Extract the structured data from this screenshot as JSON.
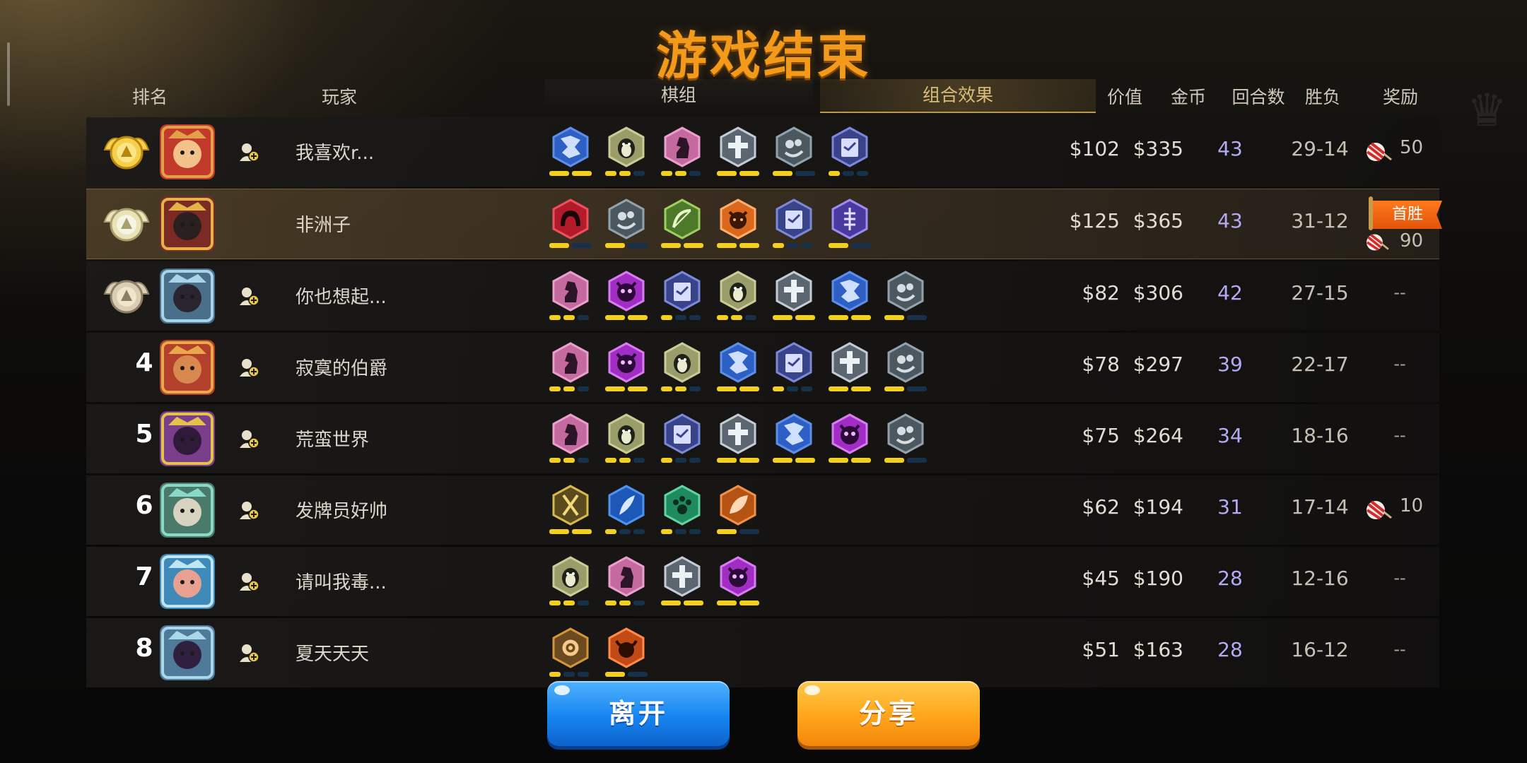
{
  "title": "游戏结束",
  "header": {
    "rank": "排名",
    "player": "玩家",
    "tab_pieces": "棋组",
    "tab_combos": "组合效果",
    "value": "价值",
    "gold": "金币",
    "rounds": "回合数",
    "winloss": "胜负",
    "reward": "奖励"
  },
  "colors": {
    "title": "#f39a1a",
    "rounds": "#b5a9f3",
    "bar_on": "#f3cf1e",
    "bar_off": "#163149"
  },
  "rows": [
    {
      "rank": "",
      "medal": "gold",
      "name": "我喜欢r...",
      "value": "$102",
      "gold": "$335",
      "rounds": "43",
      "wl": "29-14",
      "reward": "50",
      "first_win": "",
      "traits": [
        {
          "icon": "blue-rune-icon",
          "bars": [
            1,
            1
          ]
        },
        {
          "icon": "penguin-icon",
          "bars": [
            1,
            1,
            0
          ]
        },
        {
          "icon": "pink-knight-icon",
          "bars": [
            1,
            1,
            0
          ]
        },
        {
          "icon": "cross-icon",
          "bars": [
            1,
            1
          ]
        },
        {
          "icon": "grey-swirl-icon",
          "bars": [
            1,
            0
          ]
        },
        {
          "icon": "book-icon",
          "bars": [
            1,
            0,
            0
          ]
        }
      ]
    },
    {
      "rank": "",
      "medal": "silver",
      "name": "非洲子",
      "value": "$125",
      "gold": "$365",
      "rounds": "43",
      "wl": "31-12",
      "reward": "90",
      "first_win": "首胜",
      "traits": [
        {
          "icon": "red-arch-icon",
          "bars": [
            1,
            0
          ]
        },
        {
          "icon": "grey-swirl-icon",
          "bars": [
            1,
            0
          ]
        },
        {
          "icon": "bow-icon",
          "bars": [
            1,
            1
          ]
        },
        {
          "icon": "orange-demon-icon",
          "bars": [
            1,
            1
          ]
        },
        {
          "icon": "book-icon",
          "bars": [
            1,
            0,
            0
          ]
        },
        {
          "icon": "purple-fish-icon",
          "bars": [
            1,
            0
          ]
        }
      ]
    },
    {
      "rank": "",
      "medal": "bronze",
      "name": "你也想起...",
      "value": "$82",
      "gold": "$306",
      "rounds": "42",
      "wl": "27-15",
      "reward": "--",
      "first_win": "",
      "traits": [
        {
          "icon": "pink-knight-icon",
          "bars": [
            1,
            1,
            0
          ]
        },
        {
          "icon": "purple-demon-icon",
          "bars": [
            1,
            1
          ]
        },
        {
          "icon": "book-icon",
          "bars": [
            1,
            0,
            0
          ]
        },
        {
          "icon": "penguin-icon",
          "bars": [
            1,
            1,
            0
          ]
        },
        {
          "icon": "cross-icon",
          "bars": [
            1,
            1
          ]
        },
        {
          "icon": "blue-rune-icon",
          "bars": [
            1,
            1
          ]
        },
        {
          "icon": "grey-swirl-icon",
          "bars": [
            1,
            0
          ]
        }
      ]
    },
    {
      "rank": "4",
      "medal": "",
      "name": "寂寞的伯爵",
      "value": "$78",
      "gold": "$297",
      "rounds": "39",
      "wl": "22-17",
      "reward": "--",
      "first_win": "",
      "traits": [
        {
          "icon": "pink-knight-icon",
          "bars": [
            1,
            1,
            0
          ]
        },
        {
          "icon": "purple-demon-icon",
          "bars": [
            1,
            1
          ]
        },
        {
          "icon": "penguin-icon",
          "bars": [
            1,
            1,
            0
          ]
        },
        {
          "icon": "blue-rune-icon",
          "bars": [
            1,
            1
          ]
        },
        {
          "icon": "book-icon",
          "bars": [
            1,
            0,
            0
          ]
        },
        {
          "icon": "cross-icon",
          "bars": [
            1,
            1
          ]
        },
        {
          "icon": "grey-swirl-icon",
          "bars": [
            1,
            0
          ]
        }
      ]
    },
    {
      "rank": "5",
      "medal": "",
      "name": "荒蛮世界",
      "value": "$75",
      "gold": "$264",
      "rounds": "34",
      "wl": "18-16",
      "reward": "--",
      "first_win": "",
      "traits": [
        {
          "icon": "pink-knight-icon",
          "bars": [
            1,
            1,
            0
          ]
        },
        {
          "icon": "penguin-icon",
          "bars": [
            1,
            1,
            0
          ]
        },
        {
          "icon": "book-icon",
          "bars": [
            1,
            0,
            0
          ]
        },
        {
          "icon": "cross-icon",
          "bars": [
            1,
            1
          ]
        },
        {
          "icon": "blue-rune-icon",
          "bars": [
            1,
            1
          ]
        },
        {
          "icon": "purple-demon-icon",
          "bars": [
            1,
            1
          ]
        },
        {
          "icon": "grey-swirl-icon",
          "bars": [
            1,
            0
          ]
        }
      ]
    },
    {
      "rank": "6",
      "medal": "",
      "name": "发牌员好帅",
      "value": "$62",
      "gold": "$194",
      "rounds": "31",
      "wl": "17-14",
      "reward": "10",
      "first_win": "",
      "traits": [
        {
          "icon": "swords-icon",
          "bars": [
            1,
            1
          ]
        },
        {
          "icon": "blue-feather-icon",
          "bars": [
            1,
            0,
            0
          ]
        },
        {
          "icon": "paw-icon",
          "bars": [
            1,
            0,
            0
          ]
        },
        {
          "icon": "orange-leaf-icon",
          "bars": [
            1,
            0
          ]
        }
      ]
    },
    {
      "rank": "7",
      "medal": "",
      "name": "请叫我毒...",
      "value": "$45",
      "gold": "$190",
      "rounds": "28",
      "wl": "12-16",
      "reward": "--",
      "first_win": "",
      "traits": [
        {
          "icon": "penguin-icon",
          "bars": [
            1,
            1,
            0
          ]
        },
        {
          "icon": "pink-knight-icon",
          "bars": [
            1,
            1,
            0
          ]
        },
        {
          "icon": "cross-icon",
          "bars": [
            1,
            1
          ]
        },
        {
          "icon": "purple-demon-icon",
          "bars": [
            1,
            1
          ]
        }
      ]
    },
    {
      "rank": "8",
      "medal": "",
      "name": "夏天天天",
      "value": "$51",
      "gold": "$163",
      "rounds": "28",
      "wl": "16-12",
      "reward": "--",
      "first_win": "",
      "traits": [
        {
          "icon": "gear-icon",
          "bars": [
            1,
            0,
            0
          ]
        },
        {
          "icon": "orange-bull-icon",
          "bars": [
            1,
            0
          ]
        }
      ]
    }
  ],
  "buttons": {
    "leave": "离开",
    "share": "分享"
  }
}
